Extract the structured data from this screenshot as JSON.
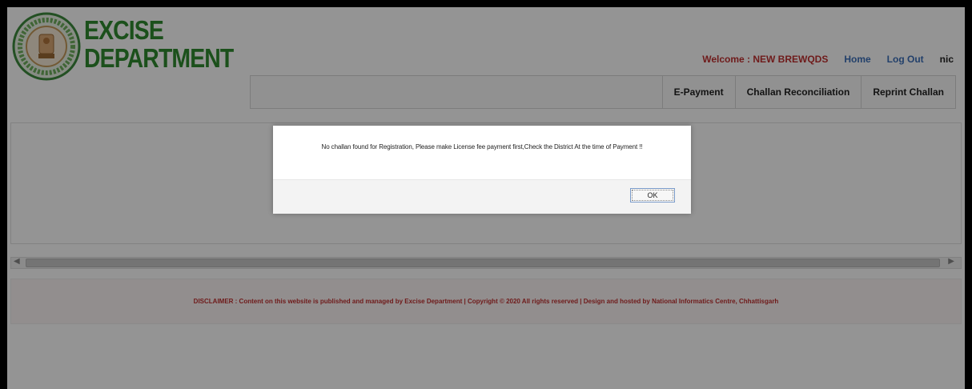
{
  "brand": {
    "line1": "EXCISE",
    "line2": "DEPARTMENT"
  },
  "topnav": {
    "welcome": "Welcome : NEW BREWQDS",
    "home": "Home",
    "logout": "Log Out",
    "nic": "nic"
  },
  "menu": {
    "items": [
      {
        "label": "E-Payment"
      },
      {
        "label": "Challan Reconciliation"
      },
      {
        "label": "Reprint Challan"
      }
    ]
  },
  "footer": {
    "disclaimer": "DISCLAIMER : Content on this website is published and managed by Excise Department | Copyright © 2020 All rights reserved | Design and hosted by National Informatics Centre, Chhattisgarh"
  },
  "dialog": {
    "message": "No challan found for Registration, Please make License fee payment first,Check the District At the time of Payment !!",
    "ok_label": "OK"
  },
  "colors": {
    "brand_green": "#2f8a2f",
    "welcome_red": "#c03030",
    "link_blue": "#3b6fb8"
  }
}
